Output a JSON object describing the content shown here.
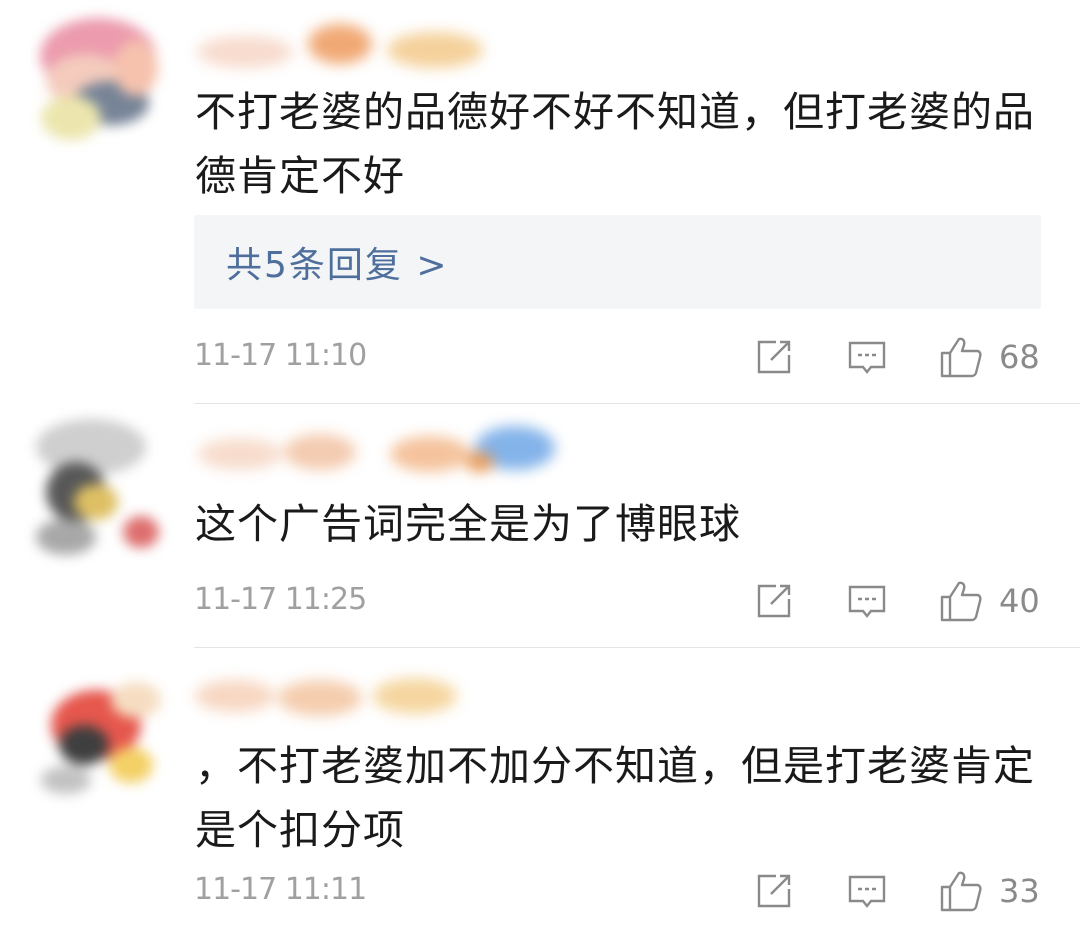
{
  "comments": [
    {
      "text": "不打老婆的品德好不好不知道，但打老婆的品德肯定不好",
      "replies_label": "共5条回复 >",
      "time": "11-17 11:10",
      "likes": "68"
    },
    {
      "text": "这个广告词完全是为了博眼球",
      "time": "11-17 11:25",
      "likes": "40"
    },
    {
      "text": "，不打老婆加不加分不知道，但是打老婆肯定是个扣分项",
      "time": "11-17 11:11",
      "likes": "33"
    }
  ],
  "icons": {
    "share": "share-icon",
    "comment": "comment-icon",
    "like": "thumbs-up-icon"
  },
  "colors": {
    "reply_link": "#4e6e9c",
    "reply_bg": "#f4f5f7",
    "meta_text": "#a0a0a0"
  }
}
